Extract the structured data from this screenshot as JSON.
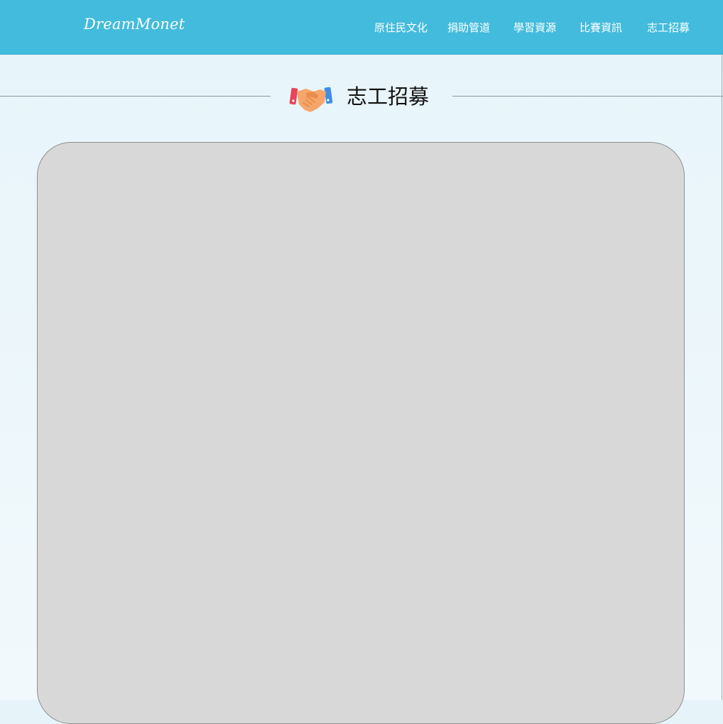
{
  "brand": "DreamMonet",
  "nav": {
    "items": [
      {
        "label": "原住民文化"
      },
      {
        "label": "捐助管道"
      },
      {
        "label": "學習資源"
      },
      {
        "label": "比賽資訊"
      },
      {
        "label": "志工招募"
      }
    ]
  },
  "section": {
    "icon": "handshake-icon",
    "title": "志工招募"
  },
  "colors": {
    "navbar": "#43bbdc",
    "card": "#d8d8d8",
    "background": "#e6f4f9"
  }
}
